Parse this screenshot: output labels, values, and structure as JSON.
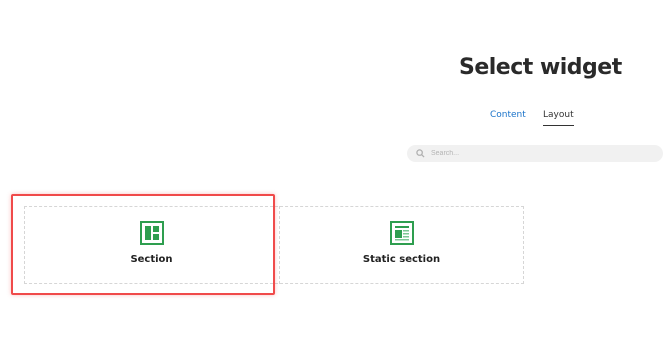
{
  "header": {
    "title": "Select widget"
  },
  "tabs": [
    {
      "label": "Content",
      "active": false
    },
    {
      "label": "Layout",
      "active": true
    }
  ],
  "search": {
    "placeholder": "Search..."
  },
  "widgets": [
    {
      "label": "Section",
      "icon": "section-icon"
    },
    {
      "label": "Static section",
      "icon": "static-section-icon"
    }
  ],
  "colors": {
    "accent": "#1a73c9",
    "icon_green": "#2e9e4f",
    "highlight": "#f04a4a"
  }
}
